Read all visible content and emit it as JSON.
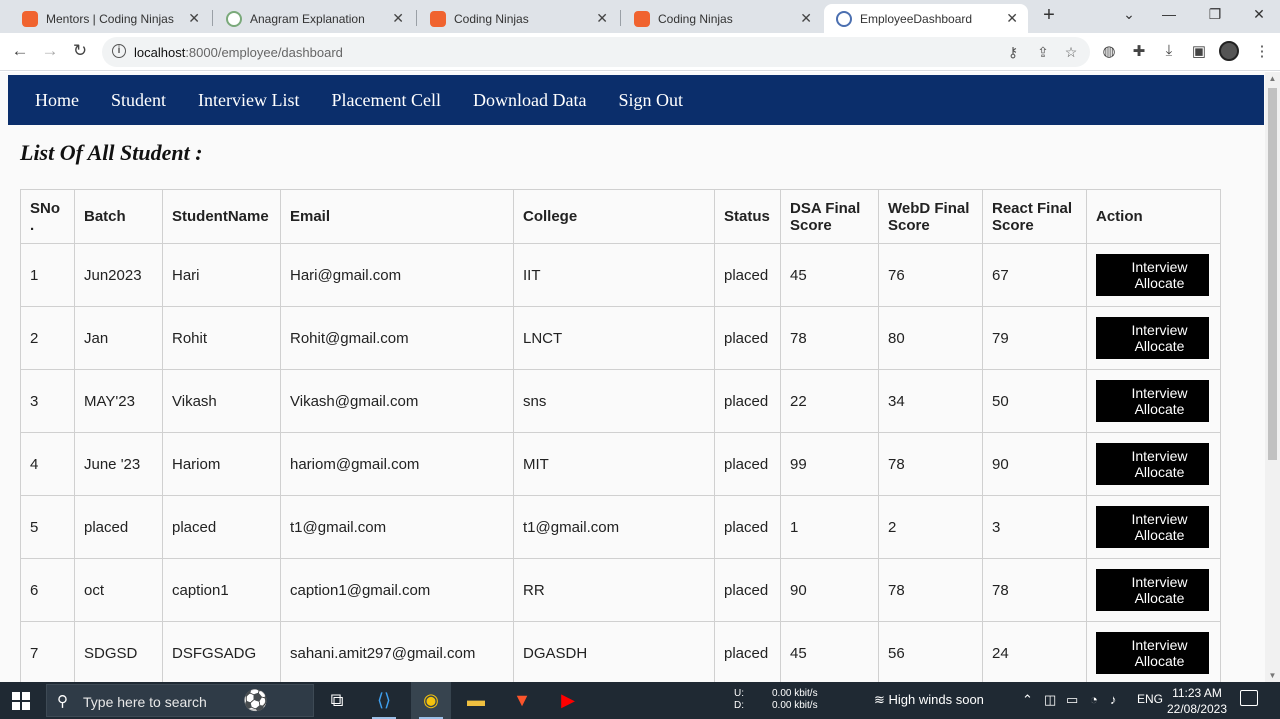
{
  "browser": {
    "tabs": [
      {
        "title": "Mentors | Coding Ninjas",
        "icon": "coding-ninjas-icon"
      },
      {
        "title": "Anagram Explanation",
        "icon": "openai-icon"
      },
      {
        "title": "Coding Ninjas",
        "icon": "coding-ninjas-icon"
      },
      {
        "title": "Coding Ninjas",
        "icon": "coding-ninjas-icon"
      },
      {
        "title": "EmployeeDashboard",
        "icon": "globe-icon",
        "active": true
      }
    ],
    "url_host": "localhost",
    "url_path": ":8000/employee/dashboard"
  },
  "nav": {
    "links": [
      "Home",
      "Student",
      "Interview List",
      "Placement Cell",
      "Download Data",
      "Sign Out"
    ],
    "background": "#0b2e6b"
  },
  "page": {
    "title": "List Of All Student :"
  },
  "table": {
    "headers": [
      "SNo\n.",
      "Batch",
      "StudentName",
      "Email",
      "College",
      "Status",
      "DSA Final\nScore",
      "WebD Final\nScore",
      "React Final\nScore",
      "Action"
    ],
    "action_label_line1": "Interview",
    "action_label_line2": "Allocate",
    "rows": [
      [
        "1",
        "Jun2023",
        "Hari",
        "Hari@gmail.com",
        "IIT",
        "placed",
        "45",
        "76",
        "67"
      ],
      [
        "2",
        "Jan",
        "Rohit",
        "Rohit@gmail.com",
        "LNCT",
        "placed",
        "78",
        "80",
        "79"
      ],
      [
        "3",
        "MAY'23",
        "Vikash",
        "Vikash@gmail.com",
        "sns",
        "placed",
        "22",
        "34",
        "50"
      ],
      [
        "4",
        "June '23",
        "Hariom",
        "hariom@gmail.com",
        "MIT",
        "placed",
        "99",
        "78",
        "90"
      ],
      [
        "5",
        "placed",
        "placed",
        "t1@gmail.com",
        "t1@gmail.com",
        "placed",
        "1",
        "2",
        "3"
      ],
      [
        "6",
        "oct",
        "caption1",
        "caption1@gmail.com",
        "RR",
        "placed",
        "90",
        "78",
        "78"
      ],
      [
        "7",
        "SDGSD",
        "DSFGSADG",
        "sahani.amit297@gmail.com",
        "DGASDH",
        "placed",
        "45",
        "56",
        "24"
      ]
    ]
  },
  "taskbar": {
    "search_placeholder": "Type here to search",
    "net_up_label": "U:",
    "net_down_label": "D:",
    "net_up": "0.00 kbit/s",
    "net_down": "0.00 kbit/s",
    "weather": "High winds soon",
    "lang": "ENG",
    "time": "11:23 AM",
    "date": "22/08/2023"
  }
}
